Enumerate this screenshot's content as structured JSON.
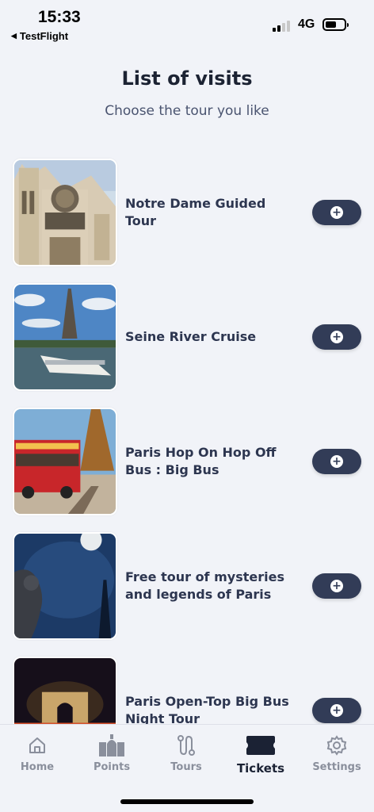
{
  "status": {
    "time": "15:33",
    "back_app": "TestFlight",
    "network": "4G"
  },
  "header": {
    "title": "List of visits",
    "subtitle": "Choose the tour you like"
  },
  "tours": [
    {
      "name": "Notre Dame Guided Tour",
      "image": "notre-dame-cathedral"
    },
    {
      "name": "Seine River Cruise",
      "image": "eiffel-tower-river-boat"
    },
    {
      "name": "Paris Hop On Hop Off Bus : Big Bus",
      "image": "red-double-decker-bus"
    },
    {
      "name": "Free tour of mysteries and legends of Paris",
      "image": "gargoyle-night-moon"
    },
    {
      "name": "Paris Open-Top Big Bus Night Tour",
      "image": "arc-de-triomphe-night"
    }
  ],
  "add_icon": "plus-circle-icon",
  "tabbar": {
    "home": "Home",
    "points": "Points",
    "tours": "Tours",
    "tickets": "Tickets",
    "settings": "Settings",
    "active": "tickets"
  },
  "colors": {
    "background": "#f1f3f8",
    "button": "#323c57",
    "text": "#2d3650"
  }
}
